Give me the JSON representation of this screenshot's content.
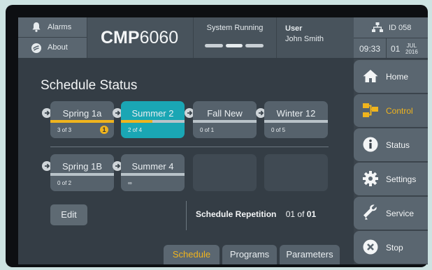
{
  "header": {
    "alarms_label": "Alarms",
    "about_label": "About",
    "brand_bold": "CMP",
    "brand_rest": "6060",
    "system_status": "System Running",
    "user_label": "User",
    "user_name": "John Smith",
    "device_id": "ID 058",
    "time": "09:33",
    "date_day": "01",
    "date_month": "JUL",
    "date_year": "2016"
  },
  "main": {
    "title": "Schedule Status",
    "schedules": [
      {
        "name": "Spring 1a",
        "count": "3 of 3",
        "progress": 1.0,
        "warning": "1",
        "active": false
      },
      {
        "name": "Summer 2",
        "count": "2 of 4",
        "progress": 0.5,
        "active": true
      },
      {
        "name": "Fall New",
        "count": "0 of 1",
        "progress": 0.0,
        "active": false
      },
      {
        "name": "Winter 12",
        "count": "0 of 5",
        "progress": 0.0,
        "active": false
      },
      {
        "name": "Spring 1B",
        "count": "0 of 2",
        "progress": 0.0,
        "active": false
      },
      {
        "name": "Summer 4",
        "count": "∞",
        "progress": 0.0,
        "active": false
      }
    ],
    "edit_label": "Edit",
    "repetition_label": "Schedule Repetition",
    "repetition_current": "01",
    "repetition_of": "of",
    "repetition_total": "01"
  },
  "tabs": [
    {
      "label": "Schedule",
      "selected": true
    },
    {
      "label": "Programs",
      "selected": false
    },
    {
      "label": "Parameters",
      "selected": false
    }
  ],
  "nav": [
    {
      "label": "Home",
      "icon": "home-icon",
      "active": false
    },
    {
      "label": "Control",
      "icon": "control-icon",
      "active": true
    },
    {
      "label": "Status",
      "icon": "info-icon",
      "active": false
    },
    {
      "label": "Settings",
      "icon": "gear-icon",
      "active": false
    },
    {
      "label": "Service",
      "icon": "wrench-icon",
      "active": false
    },
    {
      "label": "Stop",
      "icon": "stop-icon",
      "active": false
    }
  ],
  "colors": {
    "accent": "#f0b41d",
    "active_tile": "#1aa6b4",
    "panel": "#343d45"
  }
}
